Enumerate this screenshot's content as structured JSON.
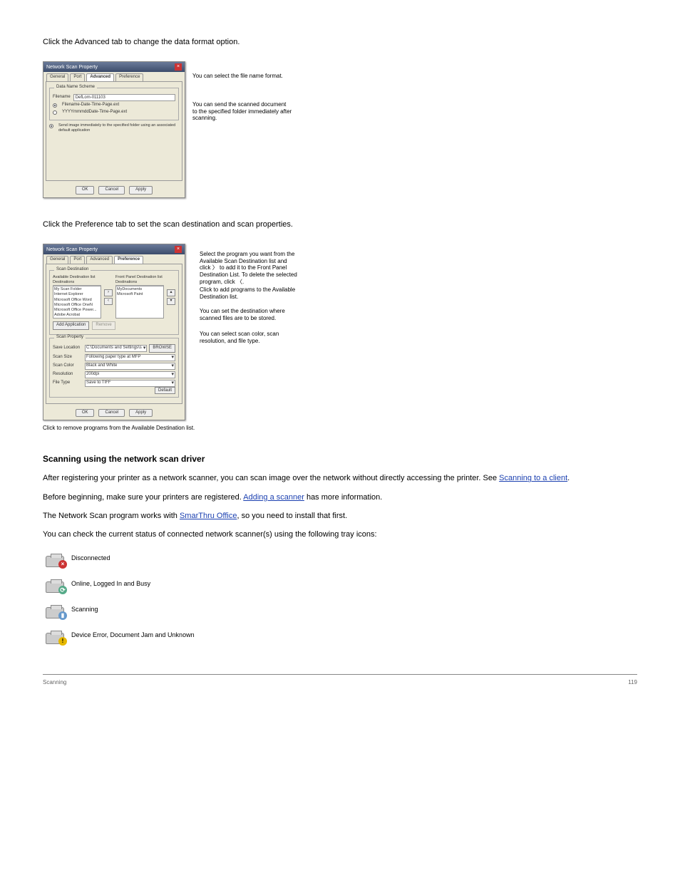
{
  "intro_para": "Click the Advanced tab to change the data format option.",
  "dialog1": {
    "title": "Network Scan Property",
    "tabs": [
      "General",
      "Port",
      "Advanced",
      "Preference"
    ],
    "active_tab": "Advanced",
    "group_title": "Data Name Scheme",
    "filename_label": "Filename",
    "filename_value": "DefLom-011103",
    "radio1": "Filename-Date-Time-Page.ext",
    "radio2": "YYYYmmmddDate-Time-Page.ext",
    "checkbox_text": "Send image immediately to the specified folder using an associated default application",
    "btn_ok": "OK",
    "btn_cancel": "Cancel",
    "btn_apply": "Apply"
  },
  "callouts1": {
    "c1": "You can select the file name format.",
    "c2": "You can send the scanned document to the specified folder immediately after scanning."
  },
  "mid_para": "Click the Preference tab to set the scan destination and scan properties.",
  "dialog2": {
    "title": "Network Scan Property",
    "tabs": [
      "General",
      "Port",
      "Advanced",
      "Preference"
    ],
    "active_tab": "Preference",
    "scan_dest_group": "Scan Destination",
    "avail_header": "Available Destination list",
    "avail_col": "Destinations",
    "avail_items": [
      "My Scan Folder",
      "Internet Explorer",
      "Microsoft Office Word",
      "Microsoft Office OneN",
      "Microsoft Office Power...",
      "Adobe Acrobat"
    ],
    "front_header": "Front Panel Destination  list",
    "front_col": "Destinations",
    "front_items": [
      "MyDocuments",
      "Microsoft Paint"
    ],
    "add_app": "Add Application",
    "remove": "Remove",
    "scan_prop_group": "Scan Property",
    "save_loc_label": "Save Location",
    "save_loc_value": "C:\\Documents and Settings\\s",
    "browse": "BROWSE",
    "scan_size_label": "Scan Size",
    "scan_size_value": "Following paper type at MFP",
    "scan_color_label": "Scan Color",
    "scan_color_value": "Black and White",
    "resolution_label": "Resolution",
    "resolution_value": "200dpi",
    "file_type_label": "File Type",
    "file_type_value": "Save to TIFF",
    "default_btn": "Default",
    "btn_ok": "OK",
    "btn_cancel": "Cancel",
    "btn_apply": "Apply"
  },
  "callouts2": {
    "d1": "Select the program you want from the Available Scan Destination list and click 〉 to add it to the Front Panel Destination List. To delete the selected program, click 〈.",
    "d2": "Click to add programs to the Available Destination list.",
    "d3": "You can set the destination where scanned files are to be stored.",
    "d4": "You can select scan color, scan resolution, and file type."
  },
  "below_caption": "Click to remove programs from the Available Destination list.",
  "heading": "Scanning using the network scan driver",
  "body_paras": {
    "p1a": "After registering your printer as a network scanner, you can scan image over the network without directly accessing the printer. See ",
    "p1_link": "Scanning to a client",
    "p1b": ".",
    "p2a": "Before beginning, make sure your printers are registered. ",
    "p2_link": "Adding a scanner",
    "p2b": " has more information.",
    "p3a": "The Network Scan program works with ",
    "p3_link": "SmarThru Office",
    "p3b": ", so you need to install that first."
  },
  "status_intro": "You can check the current status of connected network scanner(s) using the following tray icons:",
  "status": {
    "s1": "Disconnected",
    "s2": "Online, Logged In and Busy",
    "s3": "Scanning",
    "s4": "Device Error, Document Jam and Unknown"
  },
  "footer_left": "Scanning",
  "footer_right": "119"
}
